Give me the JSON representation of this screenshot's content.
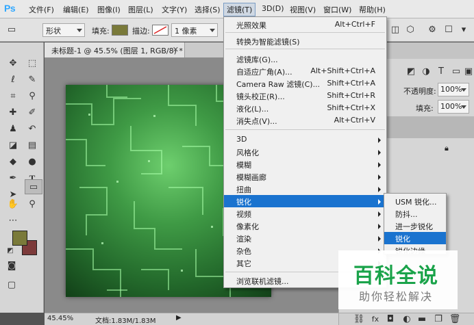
{
  "app": {
    "logo": "Ps"
  },
  "menubar": {
    "items": [
      "文件(F)",
      "编辑(E)",
      "图像(I)",
      "图层(L)",
      "文字(Y)",
      "选择(S)",
      "滤镜(T)",
      "3D(D)",
      "视图(V)",
      "窗口(W)",
      "帮助(H)"
    ],
    "active": "滤镜(T)"
  },
  "options": {
    "mode": "形状",
    "fill_label": "填充:",
    "fill_color": "#7a7a3a",
    "stroke_label": "描边:",
    "stroke_width": "1 像素"
  },
  "document": {
    "tab_title": "未标题-1 @ 45.5% (图层 1, RGB/8) *",
    "zoom": "45.45%",
    "doc_size": "文档:1.83M/1.83M",
    "canvas_colors": {
      "center": "#6ecf6e",
      "edge": "#124018"
    }
  },
  "colors": {
    "foreground": "#7a7a3a",
    "background": "#7c3a3a",
    "menu_highlight": "#1a73cf"
  },
  "right_panel": {
    "opacity_label": "不透明度:",
    "opacity_value": "100%",
    "fill_label": "填充:",
    "fill_value": "100%"
  },
  "filter_menu": {
    "group1": [
      {
        "label": "光照效果",
        "shortcut": "Alt+Ctrl+F"
      }
    ],
    "group2": [
      {
        "label": "转换为智能滤镜(S)",
        "shortcut": ""
      }
    ],
    "group3": [
      {
        "label": "滤镜库(G)...",
        "shortcut": ""
      },
      {
        "label": "自适应广角(A)...",
        "shortcut": "Alt+Shift+Ctrl+A"
      },
      {
        "label": "Camera Raw 滤镜(C)...",
        "shortcut": "Shift+Ctrl+A"
      },
      {
        "label": "镜头校正(R)...",
        "shortcut": "Shift+Ctrl+R"
      },
      {
        "label": "液化(L)...",
        "shortcut": "Shift+Ctrl+X"
      },
      {
        "label": "消失点(V)...",
        "shortcut": "Alt+Ctrl+V"
      }
    ],
    "group4": [
      "3D",
      "风格化",
      "模糊",
      "模糊画廊",
      "扭曲",
      "锐化",
      "视频",
      "像素化",
      "渲染",
      "杂色",
      "其它"
    ],
    "highlighted": "锐化",
    "group5": [
      "浏览联机滤镜..."
    ]
  },
  "sharpen_submenu": {
    "items": [
      "USM 锐化...",
      "防抖...",
      "进一步锐化",
      "锐化",
      "锐化边缘"
    ],
    "highlighted": "锐化"
  },
  "watermark": {
    "title": "百科全说",
    "subtitle": "助你轻松解决"
  }
}
